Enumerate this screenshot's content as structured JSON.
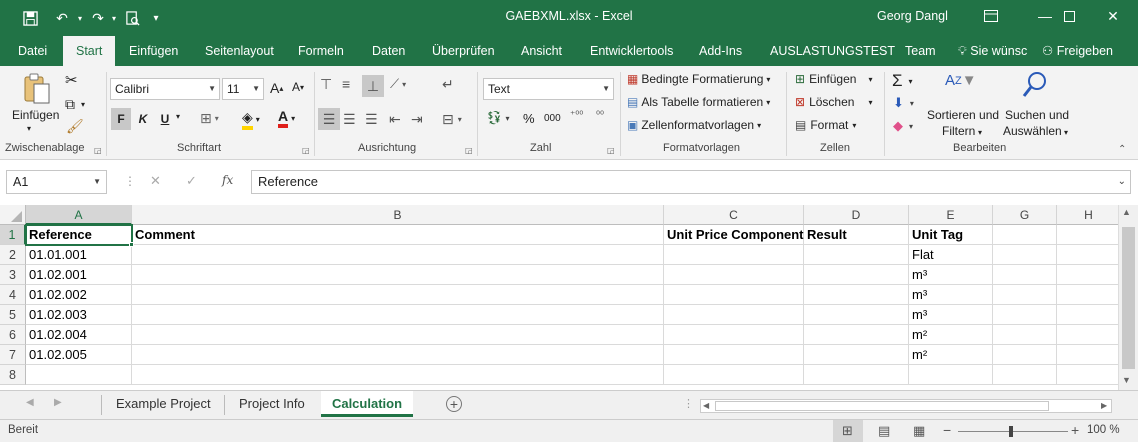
{
  "titlebar": {
    "title": "GAEBXML.xlsx - Excel",
    "user": "Georg Dangl",
    "save_icon": "save-icon",
    "undo_icon": "undo-icon",
    "redo_icon": "redo-icon"
  },
  "tabs": [
    "Datei",
    "Start",
    "Einfügen",
    "Seitenlayout",
    "Formeln",
    "Daten",
    "Überprüfen",
    "Ansicht",
    "Entwicklertools",
    "Add-Ins",
    "AUSLASTUNGSTEST",
    "Team"
  ],
  "tell_me": "Sie wünsc",
  "share": "Freigeben",
  "ribbon": {
    "clipboard": {
      "label": "Zwischenablage",
      "paste": "Einfügen"
    },
    "font": {
      "label": "Schriftart",
      "name": "Calibri",
      "size": "11",
      "bold": "F",
      "italic": "K",
      "underline": "U"
    },
    "alignment": {
      "label": "Ausrichtung"
    },
    "number": {
      "label": "Zahl",
      "format": "Text",
      "percent": "%",
      "thousands": "000"
    },
    "styles": {
      "label": "Formatvorlagen",
      "cond": "Bedingte Formatierung",
      "table": "Als Tabelle formatieren",
      "cellstyles": "Zellenformatvorlagen"
    },
    "cells": {
      "label": "Zellen",
      "insert": "Einfügen",
      "delete": "Löschen",
      "format": "Format"
    },
    "editing": {
      "label": "Bearbeiten",
      "sort1": "Sortieren und",
      "sort2": "Filtern",
      "find1": "Suchen und",
      "find2": "Auswählen"
    }
  },
  "formula": {
    "namebox": "A1",
    "fx": "fx",
    "content": "Reference"
  },
  "columns": [
    "A",
    "B",
    "C",
    "D",
    "E",
    "G",
    "H"
  ],
  "rows": [
    "1",
    "2",
    "3",
    "4",
    "5",
    "6",
    "7",
    "8"
  ],
  "cells": {
    "r1": {
      "a": "Reference",
      "b": "Comment",
      "c": "Unit Price Component",
      "d": "Result",
      "e": "Unit Tag"
    },
    "r2": {
      "a": "01.01.001",
      "e": "Flat"
    },
    "r3": {
      "a": "01.02.001",
      "e": "m³"
    },
    "r4": {
      "a": "01.02.002",
      "e": "m³"
    },
    "r5": {
      "a": "01.02.003",
      "e": "m³"
    },
    "r6": {
      "a": "01.02.004",
      "e": "m²"
    },
    "r7": {
      "a": "01.02.005",
      "e": "m²"
    }
  },
  "sheets": [
    "Example Project",
    "Project Info",
    "Calculation"
  ],
  "status": {
    "ready": "Bereit",
    "zoom": "100 %"
  }
}
